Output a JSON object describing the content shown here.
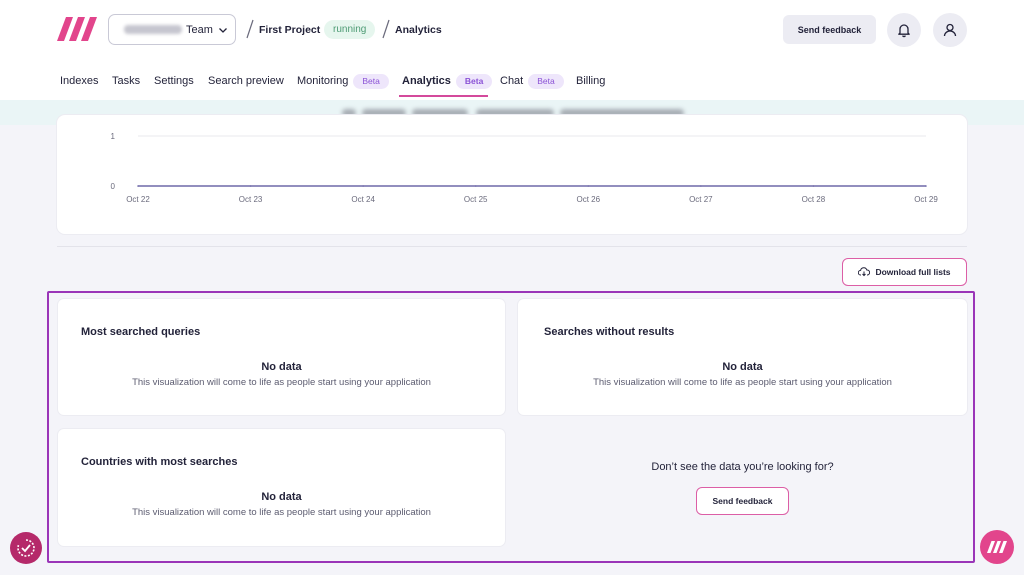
{
  "header": {
    "team_suffix": "Team",
    "project": "First Project",
    "status": "running",
    "page": "Analytics",
    "feedback_label": "Send feedback"
  },
  "nav": [
    {
      "label": "Indexes",
      "active": false,
      "badge": ""
    },
    {
      "label": "Tasks",
      "active": false,
      "badge": ""
    },
    {
      "label": "Settings",
      "active": false,
      "badge": ""
    },
    {
      "label": "Search preview",
      "active": false,
      "badge": ""
    },
    {
      "label": "Monitoring",
      "active": false,
      "badge": "Beta"
    },
    {
      "label": "Analytics",
      "active": true,
      "badge": "Beta"
    },
    {
      "label": "Chat",
      "active": false,
      "badge": "Beta"
    },
    {
      "label": "Billing",
      "active": false,
      "badge": ""
    }
  ],
  "chart_data": {
    "type": "line",
    "x": [
      "Oct 22",
      "Oct 23",
      "Oct 24",
      "Oct 25",
      "Oct 26",
      "Oct 27",
      "Oct 28",
      "Oct 29"
    ],
    "series": [
      {
        "values": [
          0,
          0,
          0,
          0,
          0,
          0,
          0,
          0
        ]
      }
    ],
    "y_ticks": [
      0,
      1
    ],
    "ylim": [
      0,
      1
    ],
    "grid": true,
    "colors": {
      "line": "#6e68a8",
      "grid": "#e8e8ee"
    }
  },
  "download_label": "Download full lists",
  "panels": {
    "queries": {
      "title": "Most searched queries",
      "empty": "No data",
      "hint": "This visualization will come to life as people start using your application"
    },
    "no_results": {
      "title": "Searches without results",
      "empty": "No data",
      "hint": "This visualization will come to life as people start using your application"
    },
    "countries": {
      "title": "Countries with most searches",
      "empty": "No data",
      "hint": "This visualization will come to life as people start using your application"
    }
  },
  "missing_data": {
    "prompt": "Don’t see the data you’re looking for?",
    "button": "Send feedback"
  },
  "colors": {
    "accent": "#dc5ea6",
    "highlight": "#9a35b8",
    "status_green": "#4d9b74"
  }
}
